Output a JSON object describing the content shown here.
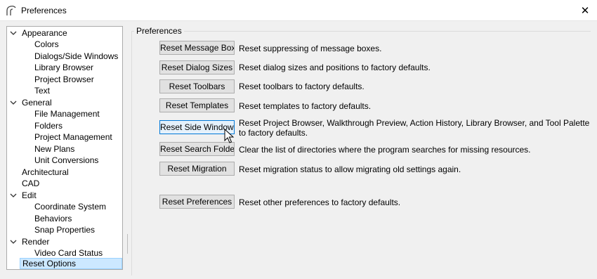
{
  "window": {
    "title": "Preferences",
    "close_glyph": "✕"
  },
  "tree": [
    {
      "label": "Appearance",
      "level": 0,
      "expanded": true
    },
    {
      "label": "Colors",
      "level": 1
    },
    {
      "label": "Dialogs/Side Windows",
      "level": 1
    },
    {
      "label": "Library Browser",
      "level": 1
    },
    {
      "label": "Project Browser",
      "level": 1
    },
    {
      "label": "Text",
      "level": 1
    },
    {
      "label": "General",
      "level": 0,
      "expanded": true
    },
    {
      "label": "File Management",
      "level": 1
    },
    {
      "label": "Folders",
      "level": 1
    },
    {
      "label": "Project Management",
      "level": 1
    },
    {
      "label": "New Plans",
      "level": 1
    },
    {
      "label": "Unit Conversions",
      "level": 1
    },
    {
      "label": "Architectural",
      "level": 0
    },
    {
      "label": "CAD",
      "level": 0
    },
    {
      "label": "Edit",
      "level": 0,
      "expanded": true
    },
    {
      "label": "Coordinate System",
      "level": 1
    },
    {
      "label": "Behaviors",
      "level": 1
    },
    {
      "label": "Snap Properties",
      "level": 1
    },
    {
      "label": "Render",
      "level": 0,
      "expanded": true
    },
    {
      "label": "Video Card Status",
      "level": 1
    },
    {
      "label": "Reset Options",
      "level": 0,
      "selected": true
    }
  ],
  "panel": {
    "group_title": "Preferences",
    "rows": [
      {
        "button": "Reset Message Boxes",
        "description": "Reset suppressing of message boxes."
      },
      {
        "button": "Reset Dialog Sizes",
        "description": "Reset dialog sizes and positions to factory defaults."
      },
      {
        "button": "Reset Toolbars",
        "description": "Reset toolbars to factory defaults."
      },
      {
        "button": "Reset Templates",
        "description": "Reset templates to factory defaults."
      },
      {
        "button": "Reset Side Windows",
        "description": "Reset Project Browser, Walkthrough Preview, Action History, Library Browser, and Tool Palette to factory defaults."
      },
      {
        "button": "Reset Search Folders",
        "description": "Clear the list of directories where the program searches for missing resources."
      },
      {
        "button": "Reset Migration",
        "description": "Reset migration status to allow migrating old settings again."
      },
      {
        "button": "Reset Preferences",
        "description": "Reset other preferences to factory defaults."
      }
    ]
  },
  "colors": {
    "selection_bg": "#cce8ff",
    "hover_border": "#0078d7"
  }
}
